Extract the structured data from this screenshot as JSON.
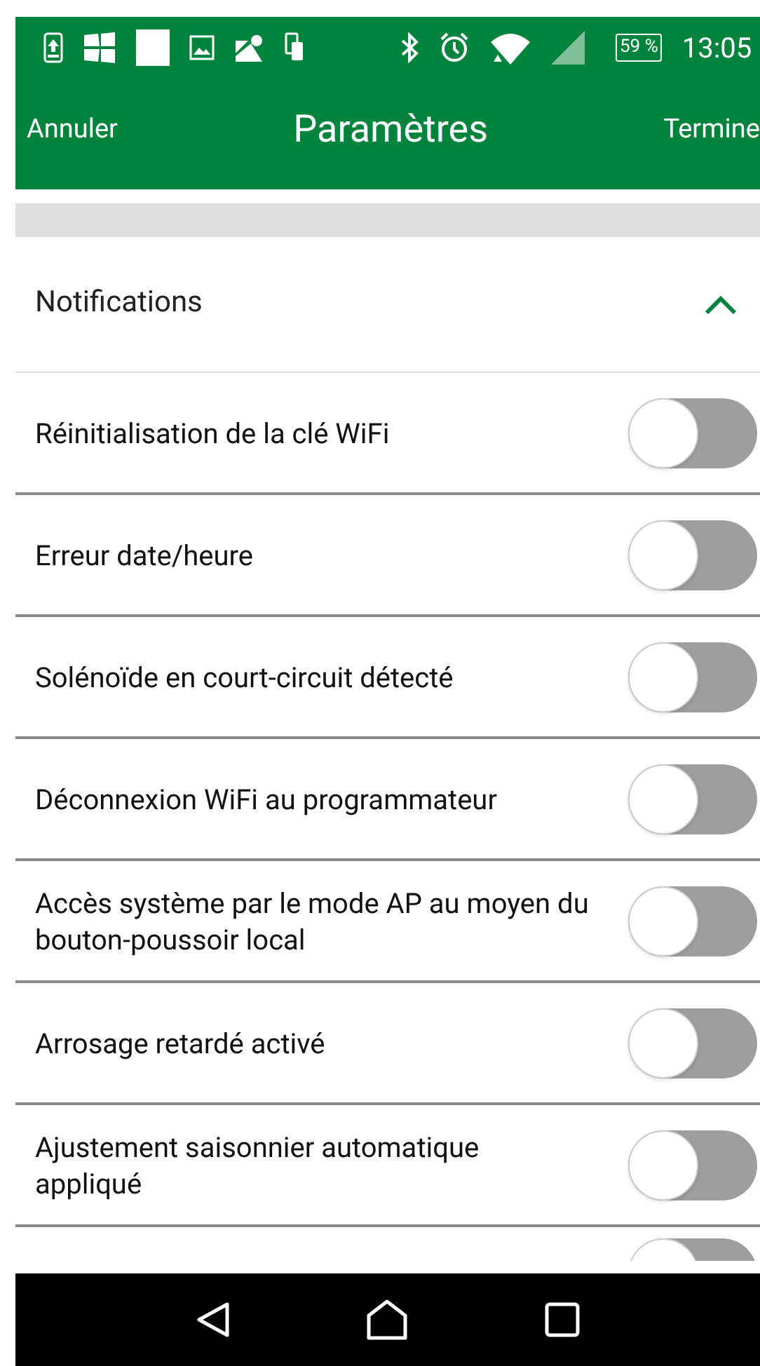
{
  "status_bar": {
    "battery": "59 %",
    "time": "13:05"
  },
  "app_bar": {
    "cancel": "Annuler",
    "title": "Paramètres",
    "done": "Termine"
  },
  "section": {
    "title": "Notifications",
    "expanded": true
  },
  "settings": [
    {
      "label": "Réinitialisation de la clé WiFi",
      "on": false
    },
    {
      "label": "Erreur date/heure",
      "on": false
    },
    {
      "label": "Solénoïde en court-circuit détecté",
      "on": false
    },
    {
      "label": "Déconnexion WiFi au programmateur",
      "on": false
    },
    {
      "label": "Accès système par le mode AP au moyen du bouton-poussoir local",
      "on": false
    },
    {
      "label": "Arrosage retardé activé",
      "on": false
    },
    {
      "label": "Ajustement saisonnier automatique appliqué",
      "on": false
    },
    {
      "on": false
    }
  ]
}
